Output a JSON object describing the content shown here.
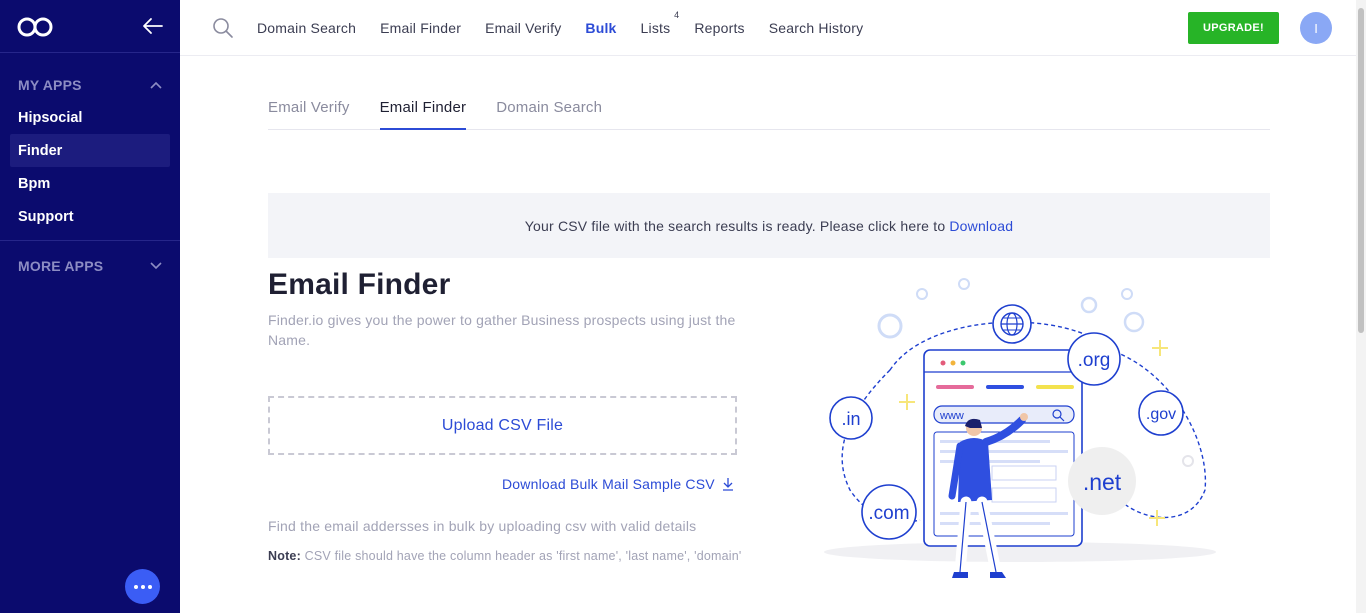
{
  "sidebar": {
    "sections": [
      {
        "title": "MY APPS",
        "expanded": true,
        "items": [
          "Hipsocial",
          "Finder",
          "Bpm",
          "Support"
        ],
        "active": "Finder"
      },
      {
        "title": "MORE APPS",
        "expanded": false
      }
    ]
  },
  "topnav": {
    "links": [
      "Domain Search",
      "Email Finder",
      "Email Verify",
      "Bulk",
      "Lists",
      "Reports",
      "Search History"
    ],
    "active": "Bulk",
    "lists_badge": "4",
    "upgrade_label": "UPGRADE!",
    "avatar_initial": "I"
  },
  "tabs": {
    "items": [
      "Email Verify",
      "Email Finder",
      "Domain Search"
    ],
    "active": "Email Finder"
  },
  "banner": {
    "text": "Your CSV file with the search results is ready. Please click here to",
    "link": "Download"
  },
  "main": {
    "title": "Email Finder",
    "description": "Finder.io gives you the power to gather Business prospects using just the Name.",
    "upload_label": "Upload CSV File",
    "sample_link": "Download Bulk Mail Sample CSV",
    "info": "Find the email addersses in bulk by uploading csv with valid details",
    "note_label": "Note:",
    "note": "CSV file should have the column header as 'first name', 'last name', 'domain'"
  },
  "illustration": {
    "domains": [
      ".org",
      ".in",
      ".gov",
      ".net",
      ".com"
    ],
    "url_text": "www"
  },
  "colors": {
    "sidebar_bg": "#0b0b6e",
    "accent": "#2c4bd6",
    "upgrade": "#27b427"
  }
}
